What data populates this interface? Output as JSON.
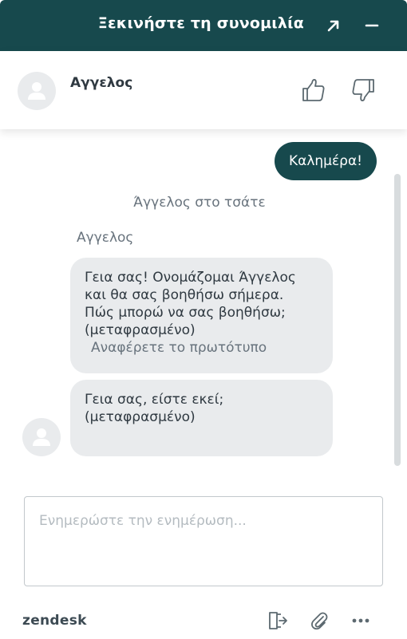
{
  "header": {
    "title": "Ξεκινήστε τη συνομιλία",
    "popout_icon": "arrow-up-right-icon",
    "minimize_icon": "minus-icon",
    "background": "#17494d"
  },
  "agent": {
    "name": "Αγγελος",
    "avatar_icon": "user-icon",
    "thumbs_up_icon": "thumbs-up-icon",
    "thumbs_down_icon": "thumbs-down-icon"
  },
  "conversation": {
    "user_message": "Καλημέρα!",
    "system_message": "Άγγελος στο τσάτε",
    "sender_label": "Αγγελος",
    "agent_message_1": {
      "lines": [
        "Γεια σας! Ονομάζομαι Άγγελος",
        "και θα σας βοηθήσω σήμερα.",
        "Πώς μπορώ να σας βοηθήσω;",
        "(μεταφρασμένο)"
      ],
      "link": "Αναφέρετε το πρωτότυπο"
    },
    "agent_message_2": {
      "lines": [
        "Γεια σας, είστε εκεί;",
        "(μεταφρασμένο)"
      ]
    }
  },
  "composer": {
    "placeholder": "Ενημερώστε την ενημέρωση..."
  },
  "footer": {
    "brand": "zendesk",
    "end_chat_icon": "exit-icon",
    "attach_icon": "paperclip-icon",
    "more_icon": "more-options-icon"
  }
}
